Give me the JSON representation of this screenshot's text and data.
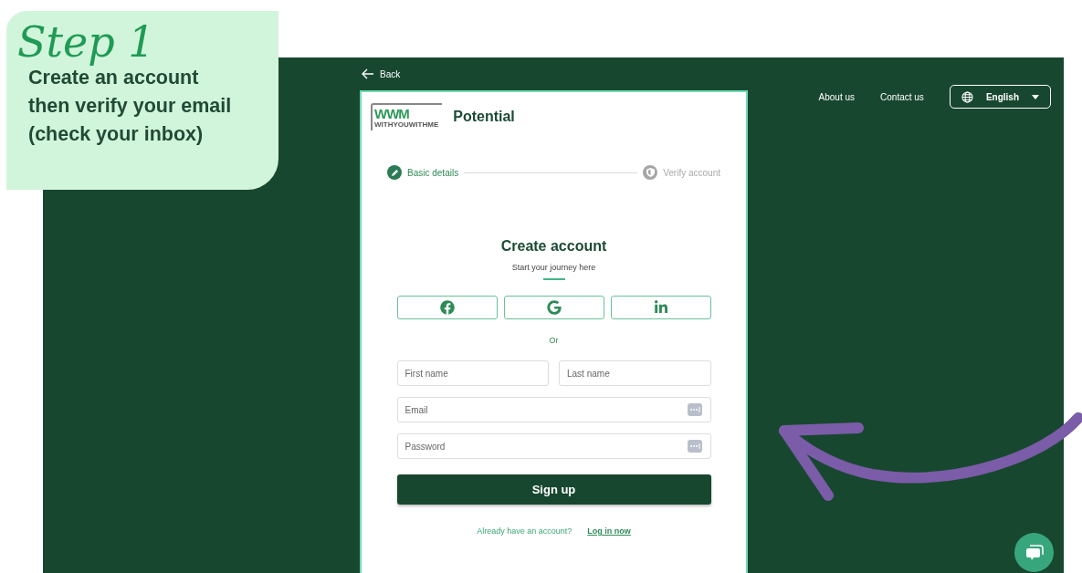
{
  "callout": {
    "heading": "Step 1",
    "lines": [
      "Create an account",
      "then verify your email",
      "(check your inbox)"
    ]
  },
  "back_link": "Back",
  "nav": {
    "links": [
      "About us",
      "Contact us"
    ],
    "language": "English"
  },
  "brand": {
    "logo_mark": "WWM",
    "logo_tagline": "WITHYOUWITHME",
    "name": "Potential"
  },
  "steps": [
    {
      "label": "Basic details",
      "selected": true
    },
    {
      "label": "Verify account",
      "selected": false
    }
  ],
  "form": {
    "title": "Create account",
    "subtitle": "Start your journey here",
    "social": [
      {
        "kind": "facebook"
      },
      {
        "kind": "google"
      },
      {
        "kind": "linkedin"
      }
    ],
    "separator": "Or",
    "name_fields": [
      {
        "placeholder": "First name"
      },
      {
        "placeholder": "Last name"
      }
    ],
    "fields": [
      {
        "placeholder": "Email",
        "kind": "autofill"
      },
      {
        "placeholder": "Password",
        "kind": "autofill"
      }
    ],
    "submit": "Sign up",
    "login_prompt": "Already have an account?",
    "login_link": "Log in now"
  }
}
